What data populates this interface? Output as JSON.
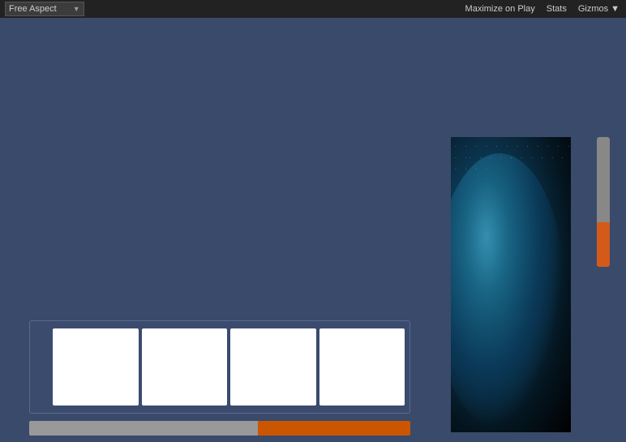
{
  "toolbar": {
    "aspect_label": "Free Aspect",
    "aspect_arrow": "▼",
    "maximize_label": "Maximize on Play",
    "stats_label": "Stats",
    "gizmos_label": "Gizmos",
    "gizmos_arrow": "▼"
  },
  "colors": {
    "toolbar_bg": "#222222",
    "main_bg": "#3a4a6b",
    "thumbnail_bg": "#ffffff",
    "progress_left": "#999999",
    "progress_right": "#cc5500",
    "slider_thumb": "#d45a1a"
  },
  "thumbnails": [
    {
      "id": 1
    },
    {
      "id": 2
    },
    {
      "id": 3
    },
    {
      "id": 4
    }
  ],
  "progress": {
    "left_pct": 60,
    "right_pct": 40
  }
}
